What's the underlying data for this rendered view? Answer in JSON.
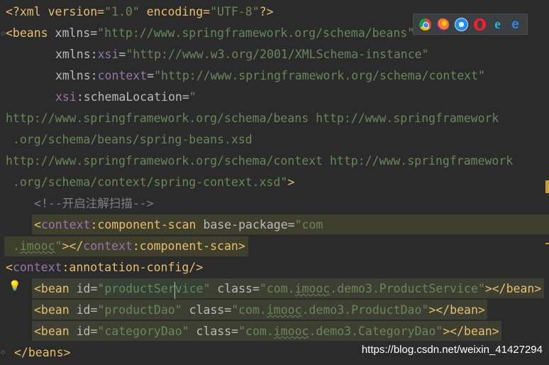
{
  "editor": {
    "lines": {
      "l1": {
        "open": "<?xml version=",
        "v1": "\"1.0\"",
        "mid": " encoding=",
        "v2": "\"UTF-8\"",
        "close": "?>"
      },
      "l2": {
        "open": "<beans ",
        "attr": "xmlns=",
        "val": "\"http://www.springframework.org/schema/beans\""
      },
      "l3": {
        "attr1": "xmlns:",
        "attr2": "xsi",
        "attr3": "=",
        "val": "\"http://www.w3.org/2001/XMLSchema-instance\""
      },
      "l4": {
        "attr1": "xmlns:",
        "attr2": "context",
        "attr3": "=",
        "val": "\"http://www.springframework.org/schema/context\""
      },
      "l5": {
        "attr1": "xsi",
        "attr2": ":schemaLocation=",
        "val": "\""
      },
      "l6": {
        "val": "http://www.springframework.org/schema/beans http://www.springframework"
      },
      "l7": {
        "val": " .org/schema/beans/spring-beans.xsd"
      },
      "l8": {
        "val": "http://www.springframework.org/schema/context http://www.springframework"
      },
      "l9": {
        "val": " .org/schema/context/spring-context.xsd\"",
        "close": ">"
      },
      "l10": {
        "comment": "<!--开启注解扫描-->"
      },
      "l11": {
        "open": "<",
        "ns": "context",
        "rest": ":component-scan ",
        "attr": "base-package=",
        "val": "\"com"
      },
      "l12": {
        "val1": " .",
        "val2": "imooc",
        "val3": "\"",
        "close1": "></",
        "ns": "context",
        "close2": ":component-scan>"
      },
      "l13": {
        "open": "<",
        "ns": "context",
        "rest": ":annotation-config/>"
      },
      "l14": {
        "open": "<bean ",
        "attr1": "id=",
        "val1a": "\"productSer",
        "val1b": "vice\"",
        "attr2": " class=",
        "val2a": "\"com.",
        "val2b": "imooc",
        "val2c": ".demo3.ProductService\"",
        "close": "></bean>"
      },
      "l15": {
        "open": "<bean ",
        "attr1": "id=",
        "val1": "\"productDao\"",
        "attr2": " class=",
        "val2a": "\"com.",
        "val2b": "imooc",
        "val2c": ".demo3.ProductDao\"",
        "close": "></bean>"
      },
      "l16": {
        "open": "<bean ",
        "attr1": "id=",
        "val1": "\"categoryDao\"",
        "attr2": " class=",
        "val2a": "\"com.",
        "val2b": "imooc",
        "val2c": ".demo3.CategoryDao\"",
        "close": "></bean>"
      },
      "l17": {
        "open": "</beans>"
      }
    }
  },
  "browsers": [
    "chrome-icon",
    "firefox-icon",
    "safari-icon",
    "opera-icon",
    "ie-icon",
    "edge-icon"
  ],
  "watermark": "https://blog.csdn.net/weixin_41427294",
  "colors": {
    "background": "#2b2b2b",
    "tag": "#e8bf6a",
    "value": "#6a8759",
    "namespace": "#9876aa",
    "highlight": "#3b3d32"
  }
}
